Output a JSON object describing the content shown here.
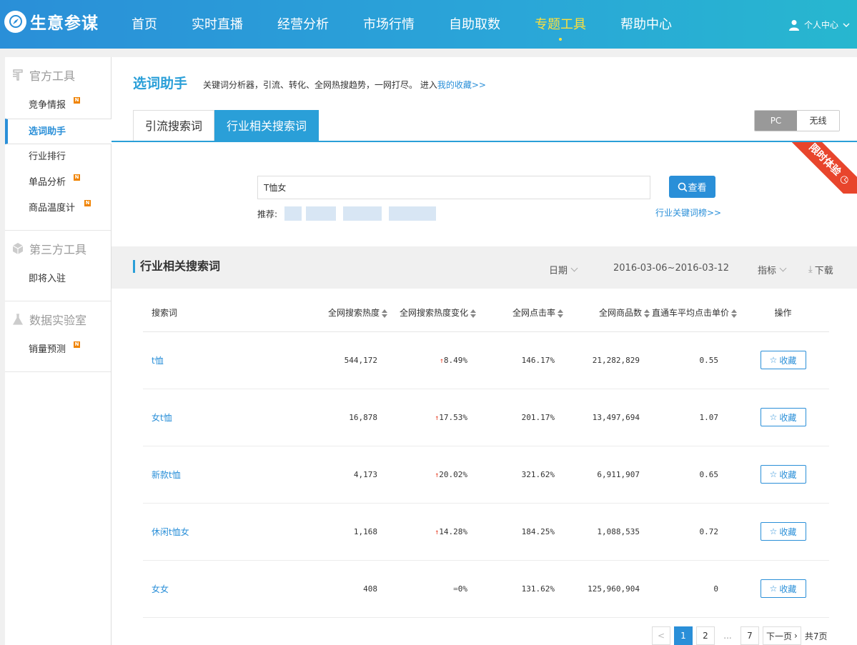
{
  "brand": {
    "name": "生意参谋"
  },
  "nav": [
    {
      "label": "首页",
      "active": false
    },
    {
      "label": "实时直播",
      "active": false
    },
    {
      "label": "经营分析",
      "active": false
    },
    {
      "label": "市场行情",
      "active": false
    },
    {
      "label": "自助取数",
      "active": false
    },
    {
      "label": "专题工具",
      "active": true
    },
    {
      "label": "帮助中心",
      "active": false
    }
  ],
  "user": {
    "label": "个人中心"
  },
  "sidebar": {
    "groups": [
      {
        "title": "官方工具",
        "icon": "official-tool-icon",
        "items": [
          {
            "label": "竞争情报",
            "badge": "N",
            "active": false
          },
          {
            "label": "选词助手",
            "badge": "",
            "active": true
          },
          {
            "label": "行业排行",
            "badge": "",
            "active": false
          },
          {
            "label": "单品分析",
            "badge": "N",
            "active": false
          },
          {
            "label": "商品温度计",
            "badge": "N",
            "active": false
          }
        ]
      },
      {
        "title": "第三方工具",
        "icon": "cube-icon",
        "items": [
          {
            "label": "即将入驻",
            "badge": "",
            "active": false
          }
        ]
      },
      {
        "title": "数据实验室",
        "icon": "flask-icon",
        "items": [
          {
            "label": "销量预测",
            "badge": "N",
            "active": false
          }
        ]
      }
    ]
  },
  "page": {
    "title": "选词助手",
    "desc": "关键词分析器，引流、转化、全网热搜趋势，一网打尽。 进入",
    "fav_link": "我的收藏>>"
  },
  "tabs": [
    {
      "label": "引流搜索词",
      "active": false
    },
    {
      "label": "行业相关搜索词",
      "active": true
    }
  ],
  "device_toggle": {
    "pc": "PC",
    "mobile": "无线"
  },
  "ribbon": {
    "label": "限时体验"
  },
  "search": {
    "value": "T恤女",
    "button": "查看",
    "rec_label": "推荐:",
    "industry_link": "行业关键词榜>>"
  },
  "section": {
    "title": "行业相关搜索词",
    "date_label": "日期",
    "date_range": "2016-03-06~2016-03-12",
    "metric_label": "指标",
    "download": "下载"
  },
  "table": {
    "headers": [
      "搜索词",
      "全网搜索热度",
      "全网搜索热度变化",
      "全网点击率",
      "全网商品数",
      "直通车平均点击单价",
      "操作"
    ],
    "rows": [
      {
        "kw": "t恤",
        "heat": "544,172",
        "change": "8.49%",
        "trend": "up",
        "ctr": "146.17%",
        "goods": "21,282,829",
        "cpc": "0.55",
        "action": "收藏"
      },
      {
        "kw": "女t恤",
        "heat": "16,878",
        "change": "17.53%",
        "trend": "up",
        "ctr": "201.17%",
        "goods": "13,497,694",
        "cpc": "1.07",
        "action": "收藏"
      },
      {
        "kw": "新款t恤",
        "heat": "4,173",
        "change": "20.02%",
        "trend": "up",
        "ctr": "321.62%",
        "goods": "6,911,907",
        "cpc": "0.65",
        "action": "收藏"
      },
      {
        "kw": "休闲t恤女",
        "heat": "1,168",
        "change": "14.28%",
        "trend": "up",
        "ctr": "184.25%",
        "goods": "1,088,535",
        "cpc": "0.72",
        "action": "收藏"
      },
      {
        "kw": "女女",
        "heat": "408",
        "change": "0%",
        "trend": "flat",
        "ctr": "131.62%",
        "goods": "125,960,904",
        "cpc": "0",
        "action": "收藏"
      }
    ]
  },
  "pager": {
    "prev": "<",
    "pages": [
      "1",
      "2"
    ],
    "dots": "...",
    "last": "7",
    "next": "下一页",
    "total": "共7页"
  },
  "colors": {
    "primary": "#2a8fd8",
    "accent": "#ffe03a",
    "ribbon": "#e8452c",
    "badge": "#f08300"
  }
}
